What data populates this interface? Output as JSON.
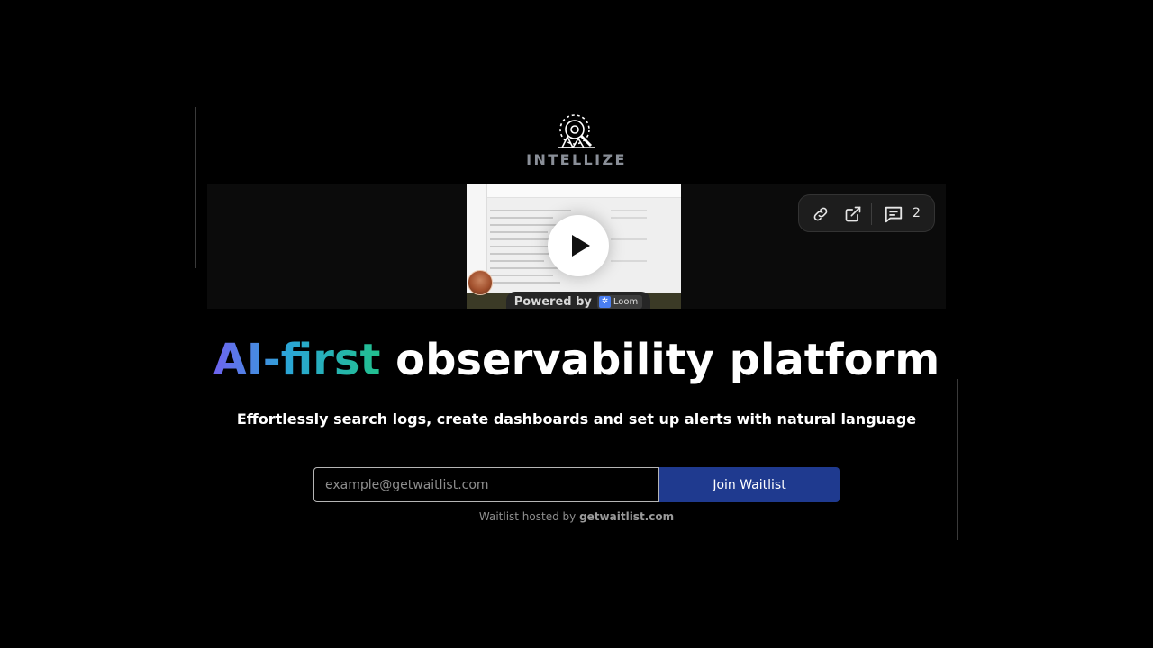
{
  "brand": {
    "name": "INTELLIZE",
    "logo_icon": "intellize-logo-icon"
  },
  "video": {
    "thumbnail": "dashboard-logs-screenshot",
    "play_icon": "play-icon",
    "powered_by": "Powered by",
    "loom_label": "Loom",
    "toolbar": {
      "link_icon": "link-icon",
      "external_icon": "external-link-icon",
      "comment_icon": "comment-icon",
      "comment_count": "2"
    }
  },
  "hero": {
    "headline_accent": "AI-first",
    "headline_rest": "observability platform",
    "subtitle": "Effortlessly search logs, create dashboards and set up alerts with natural language"
  },
  "waitlist": {
    "email_placeholder": "example@getwaitlist.com",
    "email_value": "",
    "button_label": "Join Waitlist",
    "hosted_prefix": "Waitlist hosted by",
    "hosted_link": "getwaitlist.com"
  },
  "colors": {
    "background": "#000000",
    "button": "#1f3a8f",
    "gradient_start": "#6f63f0",
    "gradient_mid": "#2aa6d6",
    "gradient_end": "#22c08e",
    "brand_text": "#8a8f98"
  }
}
